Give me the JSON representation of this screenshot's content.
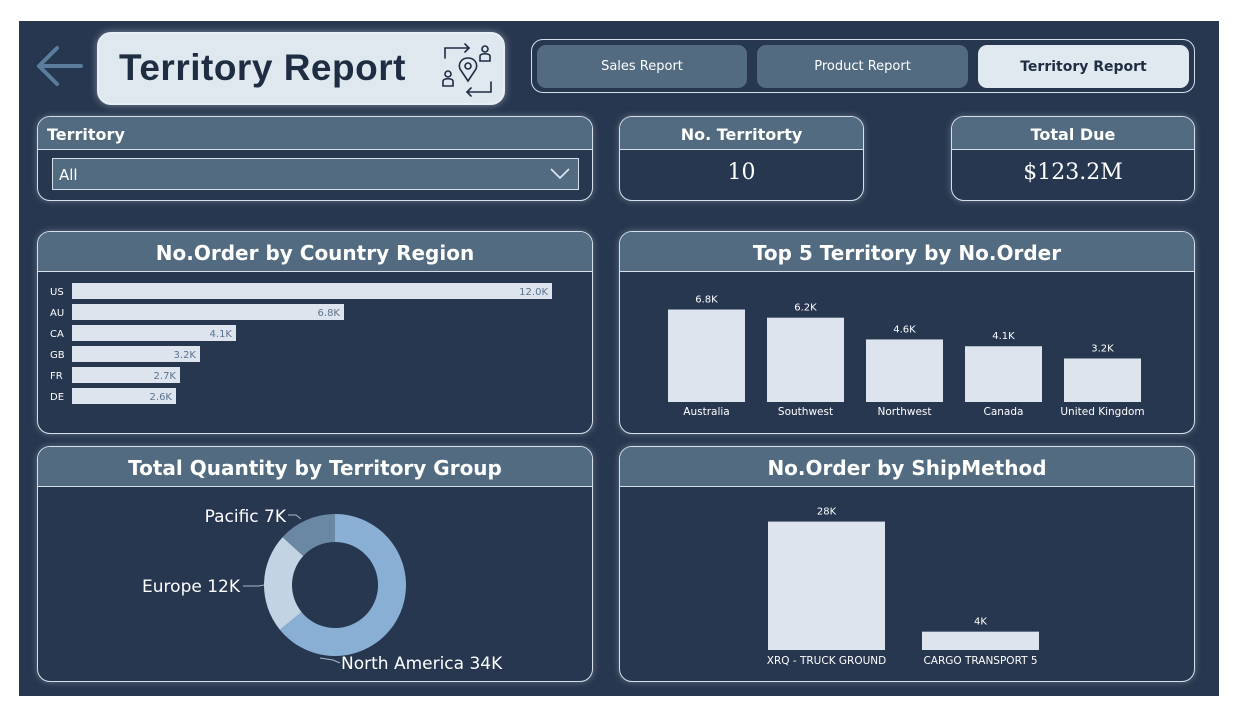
{
  "header": {
    "title": "Territory Report",
    "nav": [
      {
        "label": "Sales Report",
        "active": false
      },
      {
        "label": "Product Report",
        "active": false
      },
      {
        "label": "Territory Report",
        "active": true
      }
    ]
  },
  "filters": {
    "territory_label": "Territory",
    "territory_value": "All"
  },
  "kpis": {
    "territory_count_label": "No. Territorty",
    "territory_count_value": "10",
    "total_due_label": "Total Due",
    "total_due_value": "$123.2M"
  },
  "colors": {
    "background": "#27374f",
    "header": "#526b80",
    "bar": "#dde4ed",
    "donut_north_america": "#8aafd4",
    "donut_europe": "#c2d4e4",
    "donut_pacific": "#6a87a3"
  },
  "chart_data": [
    {
      "type": "bar",
      "orientation": "horizontal",
      "title": "No.Order by Country Region",
      "categories": [
        "US",
        "AU",
        "CA",
        "GB",
        "FR",
        "DE"
      ],
      "values": [
        12000,
        6800,
        4100,
        3200,
        2700,
        2600
      ],
      "labels": [
        "12.0K",
        "6.8K",
        "4.1K",
        "3.2K",
        "2.7K",
        "2.6K"
      ],
      "xlim": [
        0,
        12500
      ]
    },
    {
      "type": "bar",
      "title": "Top 5 Territory by No.Order",
      "categories": [
        "Australia",
        "Southwest",
        "Northwest",
        "Canada",
        "United Kingdom"
      ],
      "values": [
        6800,
        6200,
        4600,
        4100,
        3200
      ],
      "labels": [
        "6.8K",
        "6.2K",
        "4.6K",
        "4.1K",
        "3.2K"
      ],
      "ylim": [
        0,
        7500
      ]
    },
    {
      "type": "pie",
      "donut": true,
      "title": "Total Quantity by Territory Group",
      "categories": [
        "North America",
        "Europe",
        "Pacific"
      ],
      "values": [
        34000,
        12000,
        7000
      ],
      "labels": [
        "North America 34K",
        "Europe 12K",
        "Pacific 7K"
      ]
    },
    {
      "type": "bar",
      "title": "No.Order by ShipMethod",
      "categories": [
        "XRQ - TRUCK GROUND",
        "CARGO TRANSPORT 5"
      ],
      "values": [
        28000,
        4000
      ],
      "labels": [
        "28K",
        "4K"
      ],
      "ylim": [
        0,
        29000
      ]
    }
  ]
}
